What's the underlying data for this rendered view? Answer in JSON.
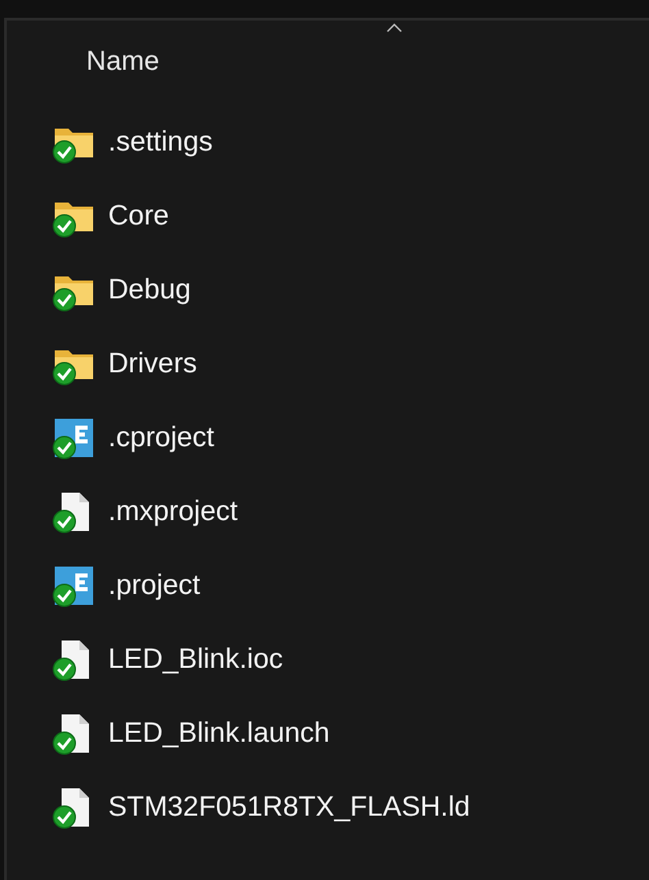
{
  "column_header": {
    "label": "Name",
    "sorted_ascending": true
  },
  "files": [
    {
      "name": ".settings",
      "kind": "folder"
    },
    {
      "name": "Core",
      "kind": "folder"
    },
    {
      "name": "Debug",
      "kind": "folder"
    },
    {
      "name": "Drivers",
      "kind": "folder"
    },
    {
      "name": ".cproject",
      "kind": "ide"
    },
    {
      "name": ".mxproject",
      "kind": "file"
    },
    {
      "name": ".project",
      "kind": "ide"
    },
    {
      "name": "LED_Blink.ioc",
      "kind": "file"
    },
    {
      "name": "LED_Blink.launch",
      "kind": "file"
    },
    {
      "name": "STM32F051R8TX_FLASH.ld",
      "kind": "file"
    }
  ]
}
